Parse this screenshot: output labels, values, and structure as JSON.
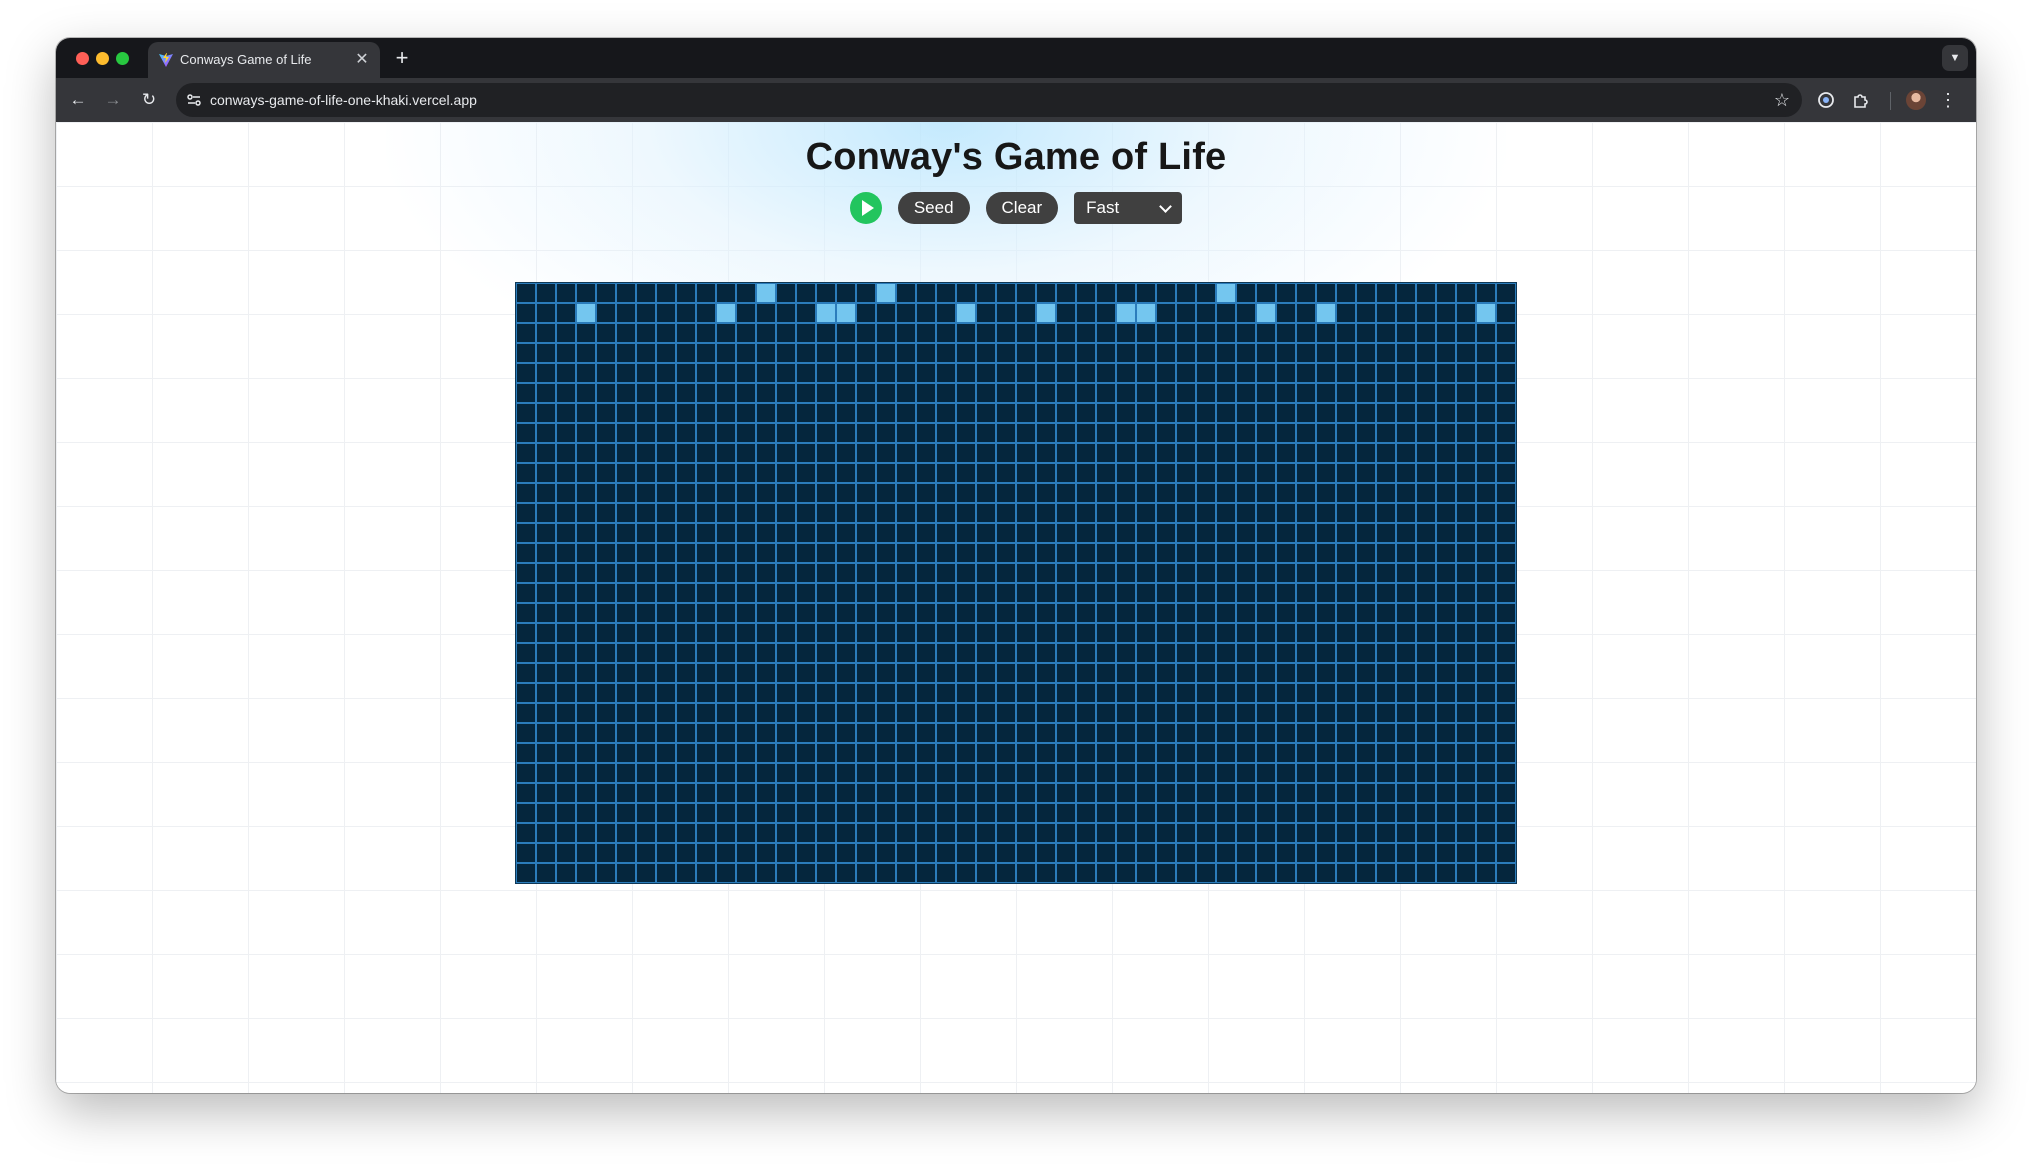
{
  "browser": {
    "tab_title": "Conways Game of Life",
    "tab_close_icon": "close-icon",
    "new_tab_icon": "plus-icon",
    "url": "conways-game-of-life-one-khaki.vercel.app"
  },
  "page": {
    "title": "Conway's Game of Life",
    "seed_label": "Seed",
    "clear_label": "Clear",
    "speed_value": "Fast"
  },
  "colors": {
    "play": "#22c55e",
    "cell_dead": "#05263d",
    "cell_alive": "#74c6ef",
    "cell_border": "#2b7cbb"
  },
  "grid": {
    "rows": 30,
    "cols": 50,
    "cells": [
      "00000000000010000010000000000000000100000000000000",
      "00010000001000011000001000100011000001001000000010",
      "00000000000000000000000000000000000000000000000000",
      "00000000000000000000000000000000000000000000000000",
      "00000000000000000000000000000000000000000000000000",
      "00000000000000000000000000000000000000000000000000",
      "00000000000000000000000000000000000000000000000000",
      "00000000000000000000000000000000000000000000000000",
      "00000000000000000000000000000000000000000000000000",
      "00000000000000000000000000000000000000000000000000",
      "00000000000000000000000000000000000000000000000000",
      "00000000000000000000000000000000000000000000000000",
      "00000000000000000000000000000000000000000000000000",
      "00000000000000000000000000000000000000000000000000",
      "00000000000000000000000000000000000000000000000000",
      "00000000000000000000000000000000000000000000000000",
      "00000000000000000000000000000000000000000000000000",
      "00000000000000000000000000000000000000000000000000",
      "00000000000000000000000000000000000000000000000000",
      "00000000000000000000000000000000000000000000000000",
      "00000000000000000000000000000000000000000000000000",
      "00000000000000000000000000000000000000000000000000",
      "00000000000000000000000000000000000000000000000000",
      "00000000000000000000000000000000000000000000000000",
      "00000000000000000000000000000000000000000000000000",
      "00000000000000000000000000000000000000000000000000",
      "00000000000000000000000000000000000000000000000000",
      "00000000000000000000000000000000000000000000000000",
      "00000000000000000000000000000000000000000000000000",
      "00000000000000000000000000000000000000000000000000"
    ]
  }
}
